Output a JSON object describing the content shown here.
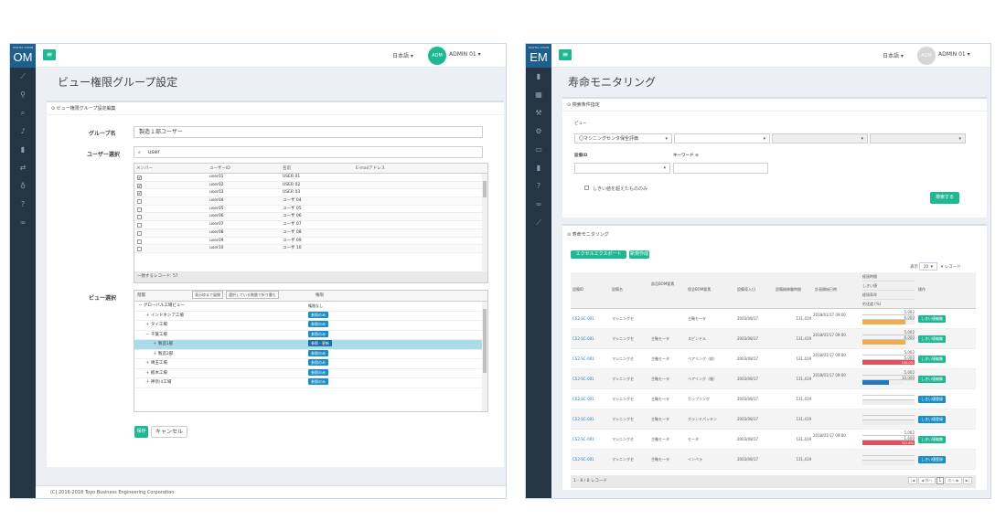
{
  "left": {
    "brand_small": "DIGITAL CHAIN",
    "brand": "OM",
    "sidebar_icons": [
      "chart-icon",
      "pin-icon",
      "search-icon",
      "bell-icon",
      "bar-chart-icon",
      "exchange-icon",
      "bulb-icon",
      "help-icon",
      "link-icon"
    ],
    "lang": "日本語 ▾",
    "avatar": "ADM",
    "user": "ADMIN 01 ▾",
    "title": "ビュー権限グループ設定",
    "panel_title": "⊙ ビュー権限グループ設定編集",
    "group_label": "グループ名",
    "group_value": "製造１部ユーザー",
    "user_label": "ユーザー選択",
    "search_value": "user",
    "search_icon": "🔍",
    "grid_headers": [
      "メンバー",
      "ユーザーID",
      "名前",
      "E-mailアドレス"
    ],
    "grid_rows": [
      {
        "checked": "✔",
        "id": "user01",
        "name": "USER 01"
      },
      {
        "checked": "✔",
        "id": "user02",
        "name": "USER 02"
      },
      {
        "checked": "✔",
        "id": "user03",
        "name": "USER 03"
      },
      {
        "checked": "",
        "id": "user04",
        "name": "ユーザ 04"
      },
      {
        "checked": "",
        "id": "user05",
        "name": "ユーザ 05"
      },
      {
        "checked": "",
        "id": "user06",
        "name": "ユーザ 06"
      },
      {
        "checked": "",
        "id": "user07",
        "name": "ユーザ 07"
      },
      {
        "checked": "",
        "id": "user08",
        "name": "ユーザ 08"
      },
      {
        "checked": "",
        "id": "user09",
        "name": "ユーザ 09"
      },
      {
        "checked": "",
        "id": "user10",
        "name": "ユーザ 10"
      }
    ],
    "grid_footer": "一致するレコード: 57",
    "view_label": "ビュー選択",
    "tree_header": "階層",
    "tree_btn1": "表示枠まで展開",
    "tree_btn2": "選択している階層で折り畳む",
    "tree_perm_header": "権限",
    "tree_rows": [
      {
        "name": "－ グローバル工場ビュー",
        "perm": "権限なし",
        "indent": 0,
        "tag": false
      },
      {
        "name": "＋ インドネシア工場",
        "perm": "参照のみ",
        "indent": 1,
        "tag": true
      },
      {
        "name": "＋ タイ工場",
        "perm": "参照のみ",
        "indent": 1,
        "tag": true
      },
      {
        "name": "－ 千葉工場",
        "perm": "参照のみ",
        "indent": 1,
        "tag": true
      },
      {
        "name": "＋ 製造1部",
        "perm": "参照・更新",
        "indent": 2,
        "tag": true
      },
      {
        "name": "＋ 製造2部",
        "perm": "参照のみ",
        "indent": 2,
        "tag": true
      },
      {
        "name": "＋ 埼玉工場",
        "perm": "参照のみ",
        "indent": 1,
        "tag": true
      },
      {
        "name": "＋ 栃木工場",
        "perm": "参照のみ",
        "indent": 1,
        "tag": true
      },
      {
        "name": "＋ 神奈川工場",
        "perm": "参照のみ",
        "indent": 1,
        "tag": true
      }
    ],
    "save": "保存",
    "cancel": "キャンセル",
    "footer": "(C) 2016-2018 Toyo Business Engineering Corporation"
  },
  "right": {
    "brand_small": "DIGITAL CHAIN",
    "brand": "EM",
    "sidebar_icons": [
      "bar-chart-icon",
      "calendar-icon",
      "wrench-icon",
      "gears-icon",
      "card-icon",
      "bar-chart-icon",
      "help-icon",
      "link-icon",
      "chart-icon"
    ],
    "lang": "日本語 ▾",
    "avatar": "ADM",
    "user": "ADMIN 01 ▾",
    "title": "寿命モニタリング",
    "cond_title": "⊙ 検索条件指定",
    "view_label": "ビュー",
    "view_select": "〇マシニングセンタ保全評価",
    "equip_label": "設備ID",
    "keyword_label": "キーワード ⊙",
    "threshold_label": "しきい値を超えたもののみ",
    "search_btn": "検索する",
    "mon_title": "⊙ 寿命モニタリング",
    "excel_btn": "エクセルエクスポート",
    "new_btn": "新規作成",
    "show_label": "表示",
    "show_value": "20",
    "records_label": "▾ レコード",
    "headers": [
      "設備ID",
      "設備名",
      "部品BOM要素",
      "保全BOM要素",
      "設備導入日",
      "設備総稼働時間",
      "計画開始日時",
      "経過時間",
      "操作"
    ],
    "sub_headers": [
      "しきい値",
      "経過寿命",
      "劣化度 (%)"
    ],
    "rows": [
      {
        "id": "CS2-SC-001",
        "name": "マシニングセ",
        "part": "",
        "bom": "主軸モータ",
        "date": "2003/08/17",
        "hours": "131,419",
        "plan": "2018/01/17 09:00",
        "v1": "5,002",
        "v2": "6,000",
        "pct": "83%",
        "fill": 0.83,
        "color": "#f0ad4e",
        "btn": "しきい値編集"
      },
      {
        "id": "CS2-SC-001",
        "name": "マシニングセ",
        "part": "主軸モータ",
        "bom": "スピンドル",
        "date": "2003/08/17",
        "hours": "131,419",
        "plan": "2018/01/17 09:00",
        "v1": "5,002",
        "v2": "6,000",
        "pct": "83%",
        "fill": 0.83,
        "color": "#f0ad4e",
        "btn": "しきい値編集"
      },
      {
        "id": "CS2-SC-001",
        "name": "マシニングセ",
        "part": "主軸モータ",
        "bom": "ベアリング（前）",
        "date": "2003/08/17",
        "hours": "131,419",
        "plan": "2018/01/17 09:00",
        "v1": "5,002",
        "v2": "5,000",
        "pct": "100.0%",
        "fill": 1.0,
        "color": "#e0505a",
        "btn": "しきい値編集"
      },
      {
        "id": "CS2-SC-001",
        "name": "マシニングセ",
        "part": "主軸モータ",
        "bom": "ベアリング（後）",
        "date": "2003/08/17",
        "hours": "131,419",
        "plan": "2018/01/17 09:00",
        "v1": "5,002",
        "v2": "10,000",
        "pct": "50.0%",
        "fill": 0.5,
        "color": "#1f78c1",
        "btn": "しきい値編集"
      },
      {
        "id": "CS2-SC-001",
        "name": "マシニングセ",
        "part": "主軸モータ",
        "bom": "カップリング",
        "date": "2003/08/17",
        "hours": "131,419",
        "plan": "",
        "v1": "",
        "v2": "",
        "pct": "",
        "fill": 0,
        "color": "",
        "btn": "しきい値登録"
      },
      {
        "id": "CS2-SC-001",
        "name": "マシニングセ",
        "part": "主軸モータ",
        "bom": "グランドパッキン",
        "date": "2003/08/17",
        "hours": "131,419",
        "plan": "",
        "v1": "",
        "v2": "",
        "pct": "",
        "fill": 0,
        "color": "",
        "btn": "しきい値登録"
      },
      {
        "id": "CS2-SC-001",
        "name": "マシニングセ",
        "part": "主軸モータ",
        "bom": "モータ",
        "date": "2003/08/17",
        "hours": "131,419",
        "plan": "2018/01/17 09:00",
        "v1": "5,002",
        "v2": "1,600",
        "pct": "312.6%",
        "fill": 1.0,
        "color": "#e0505a",
        "btn": "しきい値編集"
      },
      {
        "id": "CS2-SC-001",
        "name": "マシニングセ",
        "part": "主軸モータ",
        "bom": "インペラ",
        "date": "2003/08/17",
        "hours": "131,419",
        "plan": "",
        "v1": "",
        "v2": "",
        "pct": "",
        "fill": 0,
        "color": "",
        "btn": "しきい値登録"
      }
    ],
    "list_footer": "1 - 8 / 8 レコード",
    "pager": [
      "|◀",
      "◀ 前へ",
      "1",
      "次へ ▶",
      "▶|"
    ]
  }
}
